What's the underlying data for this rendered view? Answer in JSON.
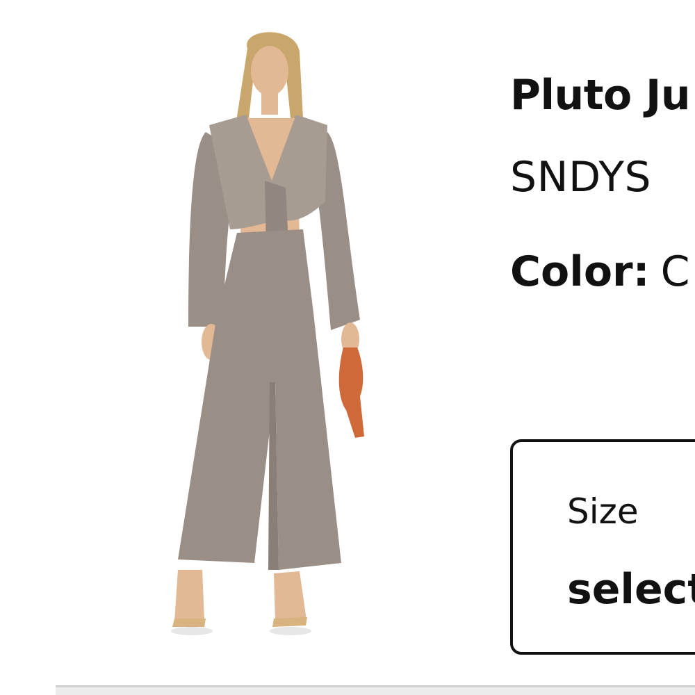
{
  "product": {
    "title": "Pluto Ju",
    "brand": "SNDYS",
    "color_label": "Color:",
    "color_value": "C",
    "image_alt": "product-photo-model-in-satin-two-piece"
  },
  "size_selector": {
    "label": "Size",
    "value": "select"
  },
  "colors": {
    "text": "#111111",
    "fabric": "#9a8f86",
    "bag": "#d0693a",
    "skin": "#e3b894",
    "hair": "#c9a66b"
  }
}
